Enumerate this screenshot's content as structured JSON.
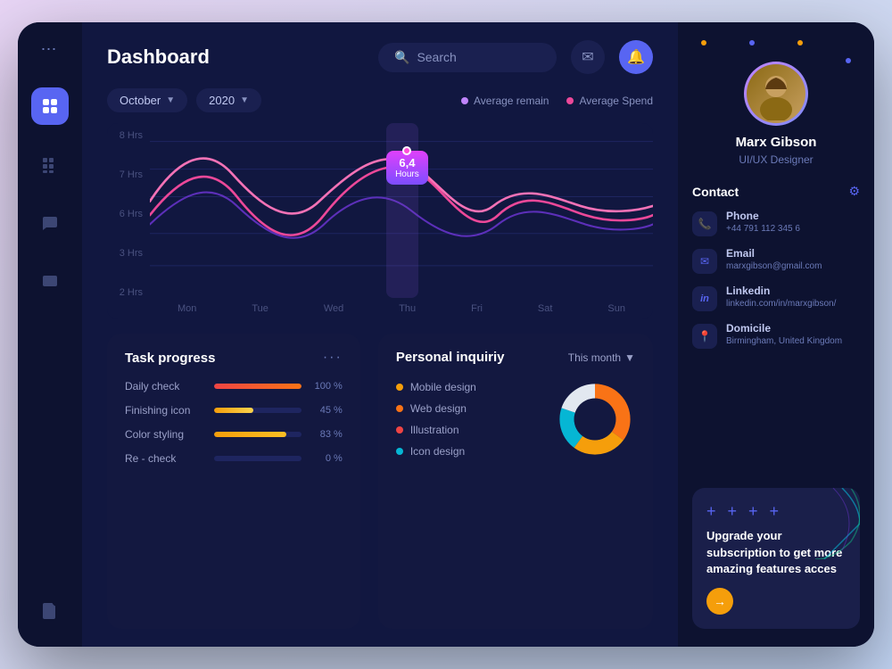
{
  "header": {
    "title": "Dashboard",
    "search_placeholder": "Search",
    "notif_icon": "🔔",
    "mail_icon": "✉"
  },
  "chart": {
    "month_label": "October",
    "year_label": "2020",
    "legend": {
      "remain_label": "Average remain",
      "spend_label": "Average Spend",
      "remain_color": "#c084fc",
      "spend_color": "#ec4899"
    },
    "y_labels": [
      "8 Hrs",
      "7 Hrs",
      "6 Hrs",
      "3 Hrs",
      "2 Hrs"
    ],
    "x_labels": [
      "Mon",
      "Tue",
      "Wed",
      "Thu",
      "Fri",
      "Sat",
      "Sun"
    ],
    "tooltip_value": "6,4",
    "tooltip_unit": "Hours"
  },
  "task_progress": {
    "title": "Task progress",
    "tasks": [
      {
        "name": "Daily check",
        "pct": 100,
        "pct_label": "100 %",
        "color": "#ef4444"
      },
      {
        "name": "Finishing icon",
        "pct": 45,
        "pct_label": "45 %",
        "color": "#f59e0b"
      },
      {
        "name": "Color styling",
        "pct": 83,
        "pct_label": "83 %",
        "color": "#f59e0b"
      },
      {
        "name": "Re - check",
        "pct": 0,
        "pct_label": "0 %",
        "color": "#10b981"
      }
    ]
  },
  "personal_inquiry": {
    "title": "Personal inquiriy",
    "period_label": "This month",
    "legend": [
      {
        "label": "Mobile design",
        "color": "#f59e0b"
      },
      {
        "label": "Web design",
        "color": "#f97316"
      },
      {
        "label": "Illustration",
        "color": "#ef4444"
      },
      {
        "label": "Icon design",
        "color": "#06b6d4"
      }
    ],
    "donut": {
      "segments": [
        {
          "value": 35,
          "color": "#f97316"
        },
        {
          "value": 25,
          "color": "#f59e0b"
        },
        {
          "value": 20,
          "color": "#06b6d4"
        },
        {
          "value": 20,
          "color": "#ffffff"
        }
      ]
    }
  },
  "profile": {
    "name": "Marx Gibson",
    "role": "UI/UX Designer",
    "avatar_emoji": "👤",
    "dots": [
      {
        "color": "#f59e0b"
      },
      {
        "color": "#5865f2"
      },
      {
        "color": "#f59e0b"
      },
      {
        "color": "#5865f2"
      }
    ]
  },
  "contact": {
    "title": "Contact",
    "items": [
      {
        "label": "Phone",
        "value": "+44 791 112 345 6",
        "icon": "📞"
      },
      {
        "label": "Email",
        "value": "marxgibson@gmail.com",
        "icon": "✉"
      },
      {
        "label": "Linkedin",
        "value": "linkedin.com/in/marxgibson/",
        "icon": "in"
      },
      {
        "label": "Domicile",
        "value": "Birmingham, United Kingdom",
        "icon": "📍"
      }
    ]
  },
  "upgrade_card": {
    "plus_dots": "+ + + +",
    "text": "Upgrade your subscription to get more amazing features acces",
    "btn_icon": "→"
  },
  "sidebar": {
    "items": [
      {
        "icon": "⋯",
        "active": false,
        "name": "dots"
      },
      {
        "icon": "▦",
        "active": true,
        "name": "dashboard"
      },
      {
        "icon": "⊞",
        "active": false,
        "name": "grid"
      },
      {
        "icon": "✉",
        "active": false,
        "name": "messages"
      },
      {
        "icon": "🖼",
        "active": false,
        "name": "gallery"
      }
    ],
    "bottom_icon": "📋"
  }
}
